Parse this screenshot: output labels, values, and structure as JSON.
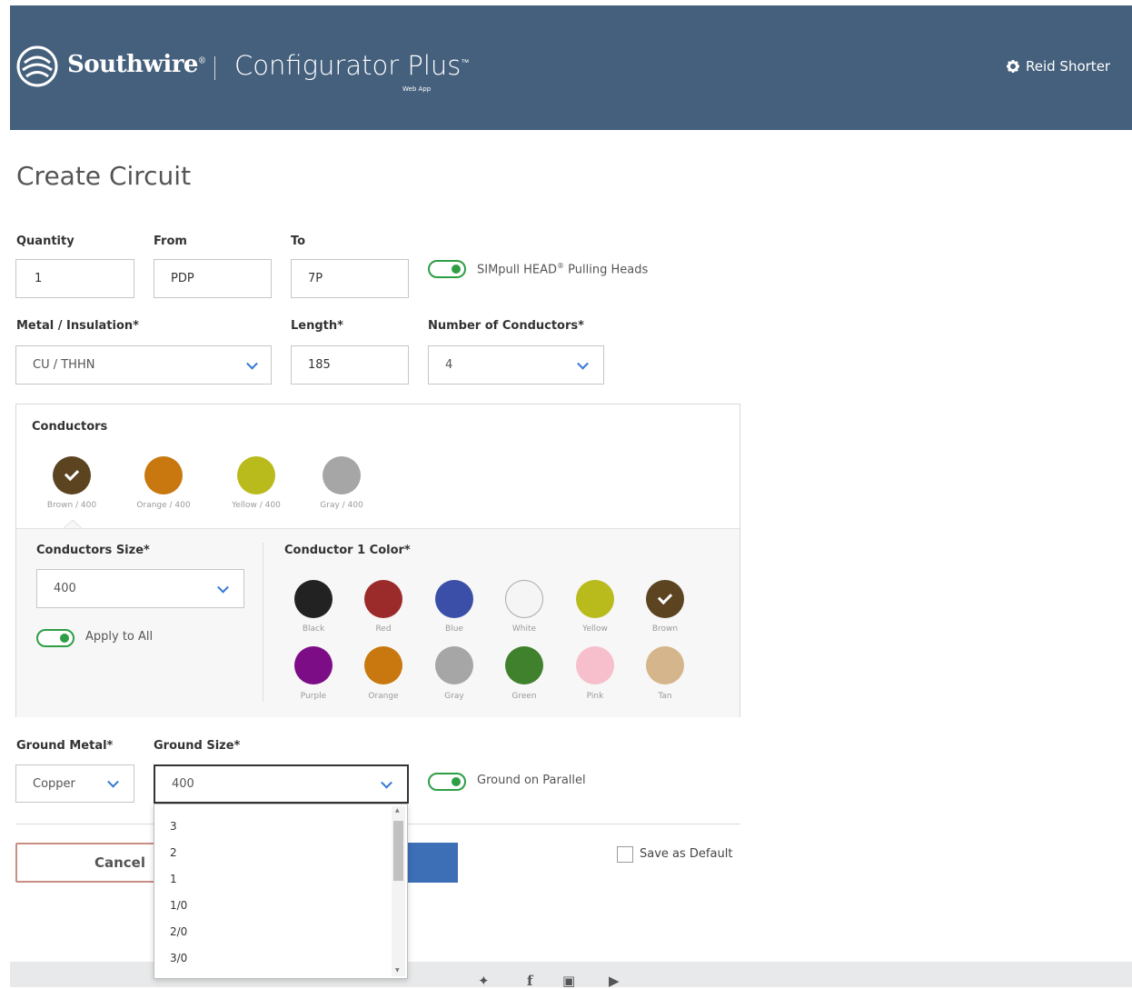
{
  "header": {
    "brand": "Southwire",
    "brand_mark": "®",
    "app_title": "Configurator Plus",
    "app_title_mark": "™",
    "app_subtitle": "Web App",
    "user_name": "Reid Shorter",
    "user_icon": "gear-icon",
    "colors": {
      "header_bg": "#45607c",
      "text": "#ffffff"
    }
  },
  "page": {
    "title": "Create Circuit"
  },
  "form": {
    "quantity": {
      "label": "Quantity",
      "value": "1"
    },
    "from": {
      "label": "From",
      "value": "PDP"
    },
    "to": {
      "label": "To",
      "value": "7P"
    },
    "pulling_heads": {
      "label": "SIMpull HEAD",
      "mark": "®",
      "suffix": " Pulling Heads",
      "on": true
    },
    "metal_insulation": {
      "label": "Metal / Insulation*",
      "value": "CU / THHN"
    },
    "length": {
      "label": "Length*",
      "value": "185"
    },
    "num_conductors": {
      "label": "Number of Conductors*",
      "value": "4"
    }
  },
  "conductors": {
    "title": "Conductors",
    "items": [
      {
        "label": "Brown / 400",
        "color": "#5c4421",
        "selected": true
      },
      {
        "label": "Orange / 400",
        "color": "#c8780f",
        "selected": false
      },
      {
        "label": "Yellow / 400",
        "color": "#b9bb1d",
        "selected": false
      },
      {
        "label": "Gray / 400",
        "color": "#a6a6a6",
        "selected": false
      }
    ],
    "size": {
      "label": "Conductors Size*",
      "value": "400"
    },
    "apply_all": {
      "label": "Apply to All",
      "on": true
    },
    "color_title": "Conductor 1 Color*",
    "colors": [
      {
        "name": "Black",
        "hex": "#222222"
      },
      {
        "name": "Red",
        "hex": "#9b2b2b"
      },
      {
        "name": "Blue",
        "hex": "#3b4fa8"
      },
      {
        "name": "White",
        "hex": "#f5f5f5"
      },
      {
        "name": "Yellow",
        "hex": "#b9bb1d"
      },
      {
        "name": "Brown",
        "hex": "#5c4421",
        "selected": true
      },
      {
        "name": "Purple",
        "hex": "#7c0d86"
      },
      {
        "name": "Orange",
        "hex": "#c8780f"
      },
      {
        "name": "Gray",
        "hex": "#a6a6a6"
      },
      {
        "name": "Green",
        "hex": "#3f812c"
      },
      {
        "name": "Pink",
        "hex": "#f6bfcb"
      },
      {
        "name": "Tan",
        "hex": "#d5b58b"
      }
    ]
  },
  "ground": {
    "metal": {
      "label": "Ground Metal*",
      "value": "Copper"
    },
    "size": {
      "label": "Ground Size*",
      "value": "400"
    },
    "parallel": {
      "label": "Ground on Parallel",
      "on": true
    },
    "options_visible": [
      "3",
      "2",
      "1",
      "1/0",
      "2/0",
      "3/0"
    ]
  },
  "actions": {
    "cancel": "Cancel",
    "save_default": "Save as Default"
  },
  "footer": {
    "icons": [
      "twitter-icon",
      "facebook-icon",
      "linkedin-icon",
      "youtube-icon"
    ]
  }
}
